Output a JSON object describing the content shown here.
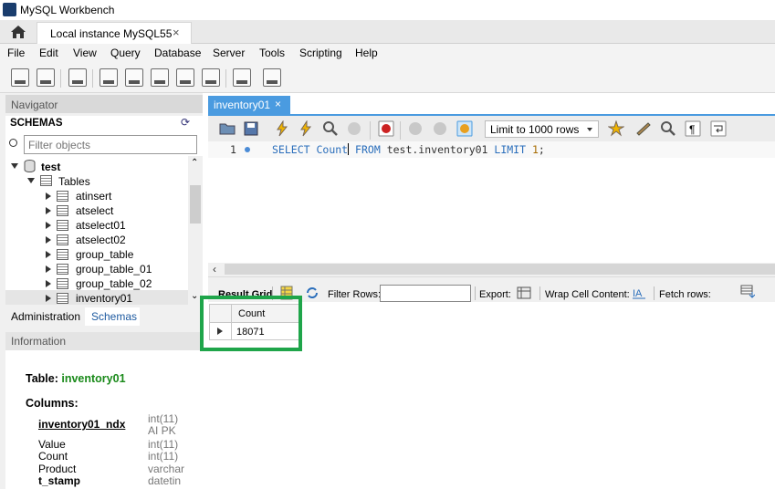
{
  "window": {
    "title": "MySQL Workbench"
  },
  "connection_tab": {
    "label": "Local instance MySQL55",
    "close": "×"
  },
  "menu": [
    "File",
    "Edit",
    "View",
    "Query",
    "Database",
    "Server",
    "Tools",
    "Scripting",
    "Help"
  ],
  "navigator": {
    "header": "Navigator",
    "schemas_label": "SCHEMAS",
    "filter_placeholder": "Filter objects",
    "schema": "test",
    "tables_label": "Tables",
    "tables": [
      "atinsert",
      "atselect",
      "atselect01",
      "atselect02",
      "group_table",
      "group_table_01",
      "group_table_02",
      "inventory01"
    ],
    "selected_table": "inventory01"
  },
  "left_tabs": {
    "administration": "Administration",
    "schemas": "Schemas"
  },
  "information": {
    "header": "Information",
    "table_prefix": "Table: ",
    "table_name": "inventory01",
    "columns_label": "Columns:",
    "columns": [
      {
        "name": "inventory01_ndx",
        "type": "int(11)",
        "extra": "AI PK"
      },
      {
        "name": "Value",
        "type": "int(11)"
      },
      {
        "name": "Count",
        "type": "int(11)"
      },
      {
        "name": "Product",
        "type": "varchar"
      },
      {
        "name": "t_stamp",
        "type": "datetin"
      }
    ]
  },
  "editor": {
    "tab_label": "inventory01",
    "tab_close": "×",
    "limit_label": "Limit to 1000 rows",
    "line_number": "1",
    "sql": {
      "k1": "SELECT",
      "k2": "Count",
      "k3": "FROM",
      "ident": "test.inventory01",
      "k4": "LIMIT",
      "num": "1",
      "end": ";"
    }
  },
  "result_toolbar": {
    "result_grid": "Result Grid",
    "filter_rows": "Filter Rows:",
    "export": "Export:",
    "wrap_cell": "Wrap Cell Content:",
    "fetch_rows": "Fetch rows:"
  },
  "result_grid": {
    "column": "Count",
    "value": "18071"
  },
  "colors": {
    "accent": "#4a9be0",
    "highlight": "#1fa54a",
    "keyword": "#2a6ebb"
  }
}
